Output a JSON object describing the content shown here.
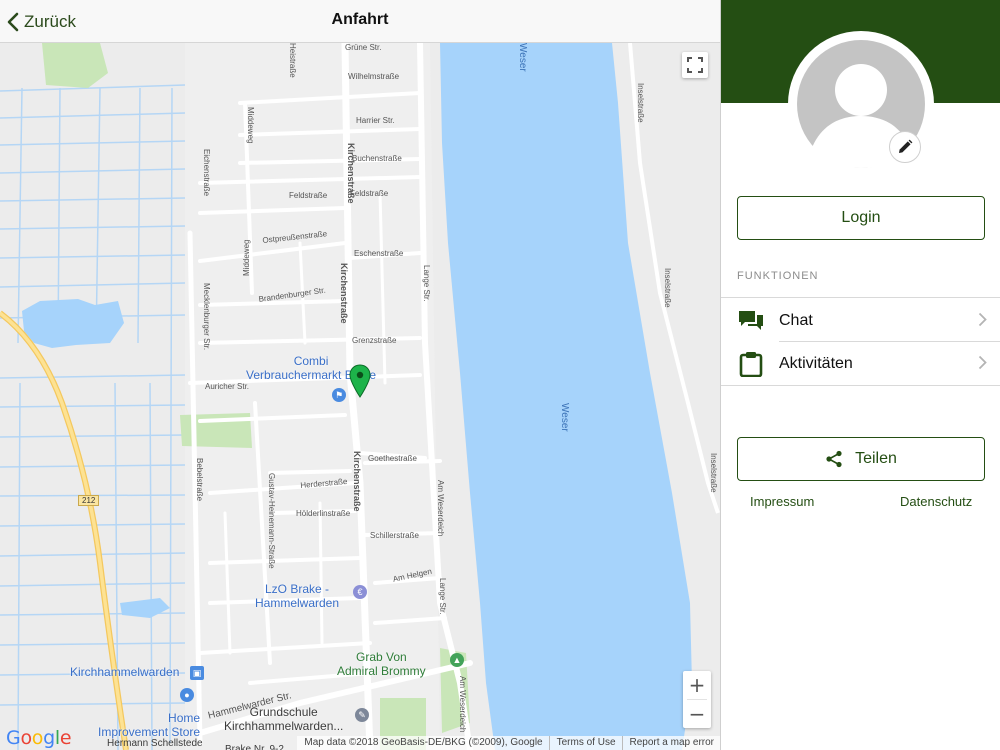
{
  "nav": {
    "back_label": "Zurück",
    "title": "Anfahrt"
  },
  "map": {
    "streets": [
      "Grüne Str.",
      "Wilhelmstraße",
      "Harrier Str.",
      "Buchenstraße",
      "Feldstraße",
      "Feldstraße",
      "Eschenstraße",
      "Ostpreußenstraße",
      "Brandenburger Str.",
      "Grenzstraße",
      "Goethestraße",
      "Herderstraße",
      "Hölderlinstraße",
      "Schillerstraße",
      "Am Helgen",
      "Hammelwarder Str.",
      "Auricher Str.",
      "Kirchenstraße",
      "Kirchenstraße",
      "Kirchenstraße",
      "Lange Str.",
      "Lange Str.",
      "Am Weserdeich",
      "Am Weserdeich",
      "Mecklenburger Str.",
      "Middeweg",
      "Middeweg",
      "Eichenstraße",
      "Bebelstraße",
      "Gustav-Heinemann-Straße",
      "Inselstraße",
      "Inselstraße",
      "Inselstraße",
      "Weser",
      "Weser",
      "Heistraße",
      "212"
    ],
    "pois": {
      "combi": "Combi\nVerbrauchermarkt Brake",
      "lzo": "LzO Brake -\nHammelwarden",
      "grab": "Grab Von\nAdmiral Brommy",
      "kirch": "Kirchhammelwarden",
      "home": "Home\nImprovement Store",
      "hermann": "Hermann Schellstede",
      "grundschule": "Grundschule\nKirchhammelwarden...",
      "bottom": "Brake Nr. 9-2"
    },
    "google_logo": "Google",
    "attribution": {
      "data": "Map data ©2018 GeoBasis-DE/BKG (©2009), Google",
      "terms": "Terms of Use",
      "report": "Report a map error"
    },
    "controls": {
      "zoom_in": "+",
      "zoom_out": "−"
    }
  },
  "sidebar": {
    "login_label": "Login",
    "section_title": "FUNKTIONEN",
    "menu": [
      {
        "label": "Chat",
        "icon": "chat-icon"
      },
      {
        "label": "Aktivitäten",
        "icon": "clipboard-icon"
      }
    ],
    "share_label": "Teilen",
    "footer": {
      "impressum": "Impressum",
      "datenschutz": "Datenschutz"
    }
  },
  "colors": {
    "brand_green": "#244e13",
    "river": "#a6d3fb",
    "map_land": "#ececec",
    "pin": "#1db34a"
  }
}
